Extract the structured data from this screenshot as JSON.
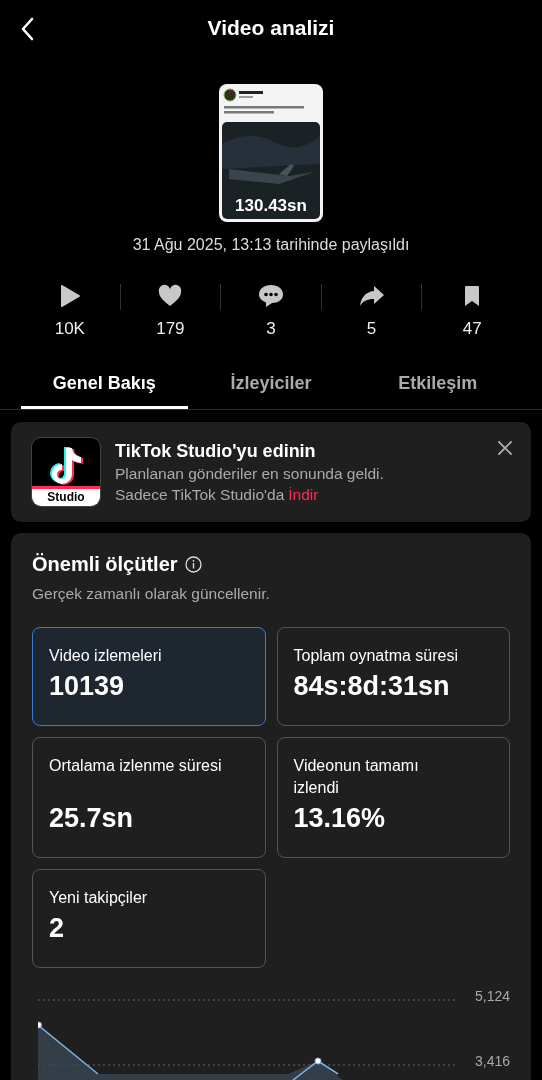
{
  "header": {
    "title": "Video analizi"
  },
  "video": {
    "duration": "130.43sn",
    "posted": "31 Ağu 2025, 13:13 tarihinde paylaşıldı"
  },
  "stats": [
    {
      "kind": "play",
      "value": "10K"
    },
    {
      "kind": "like",
      "value": "179"
    },
    {
      "kind": "comment",
      "value": "3"
    },
    {
      "kind": "share",
      "value": "5"
    },
    {
      "kind": "save",
      "value": "47"
    }
  ],
  "tabs": [
    {
      "label": "Genel Bakış",
      "selected": true
    },
    {
      "label": "İzleyiciler",
      "selected": false
    },
    {
      "label": "Etkileşim",
      "selected": false
    }
  ],
  "banner": {
    "app_label": "Studio",
    "title": "TikTok Studio'yu edinin",
    "line_1": "Planlanan gönderiler en sonunda geldi.",
    "line_2": "Sadece TikTok Studio'da",
    "link": "İndir"
  },
  "metrics_section": {
    "title": "Önemli ölçütler",
    "subtitle": "Gerçek zamanlı olarak güncellenir.",
    "metrics": [
      {
        "label": "Video izlemeleri",
        "value": "10139",
        "selected": true
      },
      {
        "label": "Toplam oynatma süresi",
        "value": "84s:8d:31sn",
        "selected": false
      },
      {
        "label": "Ortalama izlenme süresi",
        "value": "25.7sn",
        "selected": false
      },
      {
        "label": "Videonun tamamı izlendi",
        "value": "13.16%",
        "selected": false
      },
      {
        "label": "Yeni takipçiler",
        "value": "2",
        "selected": false
      }
    ],
    "chart_ticks": [
      "5,124",
      "3,416"
    ]
  }
}
